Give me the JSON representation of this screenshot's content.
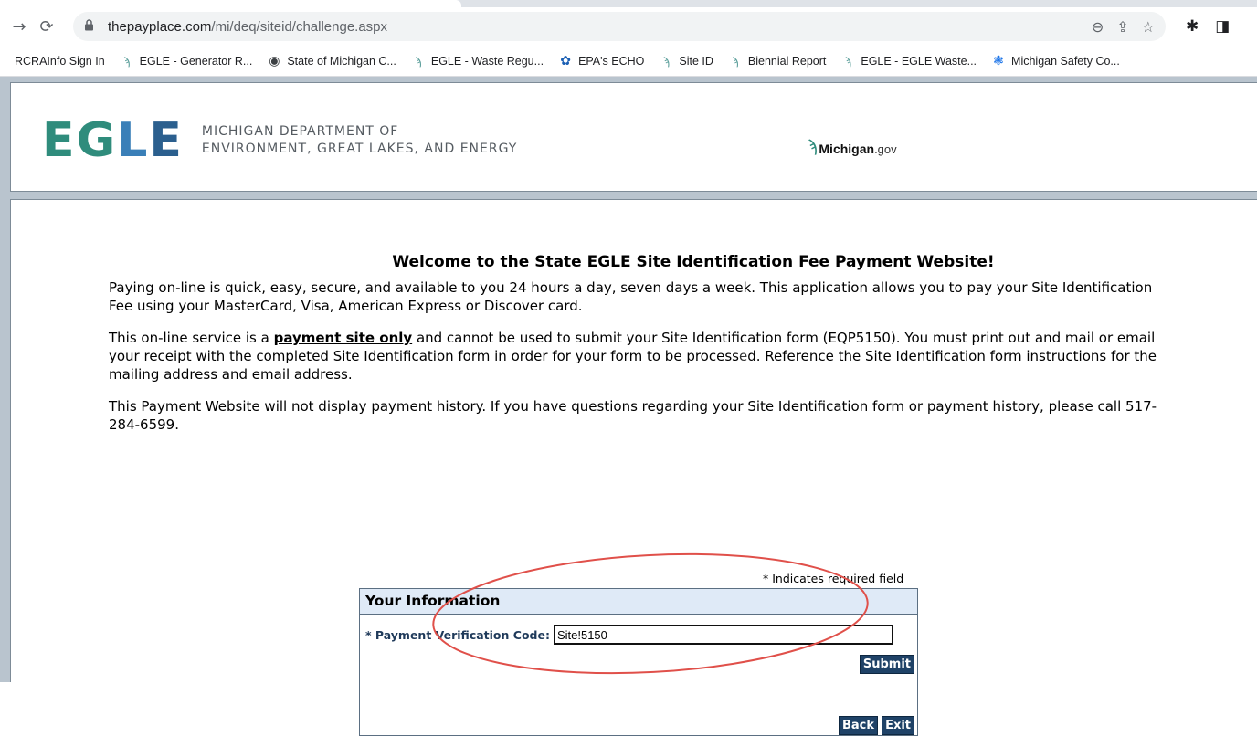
{
  "browser": {
    "url_host": "thepayplace.com",
    "url_path": "/mi/deq/siteid/challenge.aspx",
    "bookmarks": [
      {
        "label": "RCRAInfo Sign In",
        "icon": "none"
      },
      {
        "label": "EGLE - Generator R...",
        "icon": "michigan-mitten-icon"
      },
      {
        "label": "State of Michigan C...",
        "icon": "globe-icon"
      },
      {
        "label": "EGLE - Waste Regu...",
        "icon": "michigan-mitten-icon"
      },
      {
        "label": "EPA's ECHO",
        "icon": "epa-icon"
      },
      {
        "label": "Site ID",
        "icon": "michigan-mitten-icon"
      },
      {
        "label": "Biennial Report",
        "icon": "michigan-mitten-icon"
      },
      {
        "label": "EGLE - EGLE Waste...",
        "icon": "michigan-mitten-icon"
      },
      {
        "label": "Michigan Safety Co...",
        "icon": "safety-icon"
      }
    ]
  },
  "header": {
    "logo_letters": "EGLE",
    "dept_line1": "MICHIGAN DEPARTMENT OF",
    "dept_line2": "ENVIRONMENT, GREAT LAKES, AND ENERGY",
    "michigan_gov_name": "Michigan",
    "michigan_gov_suffix": ".gov"
  },
  "main": {
    "welcome": "Welcome to the State EGLE Site Identification Fee Payment Website!",
    "p1": "Paying on-line is quick, easy, secure, and available to you 24 hours a day, seven days a week. This application allows you to pay your Site Identification Fee using your MasterCard, Visa, American Express or Discover card.",
    "p2_before": "This on-line service is a ",
    "p2_bold": "payment site only",
    "p2_mid": " and cannot be used to submit your Site Identification form (EQP5150). You must print out and mail or email your receipt with the completed Site Identification form in order for your form to be process",
    "p2_after": "d.  Reference the Site Identification form instructions for the mailing address and email address.",
    "p3": "This Payment Website will not display payment history. If you have questions regarding your Site Identification form or payment history, please call 517-284-6599."
  },
  "form": {
    "required_note": "* Indicates required field",
    "title": "Your Information",
    "code_label": "* Payment Verification Code:",
    "code_value": "Site!5150",
    "submit_label": "Submit",
    "back_label": "Back",
    "exit_label": "Exit"
  },
  "colors": {
    "button_bg": "#1f4267",
    "form_title_bg": "#dfeaf7",
    "annotation": "#e0504a"
  }
}
